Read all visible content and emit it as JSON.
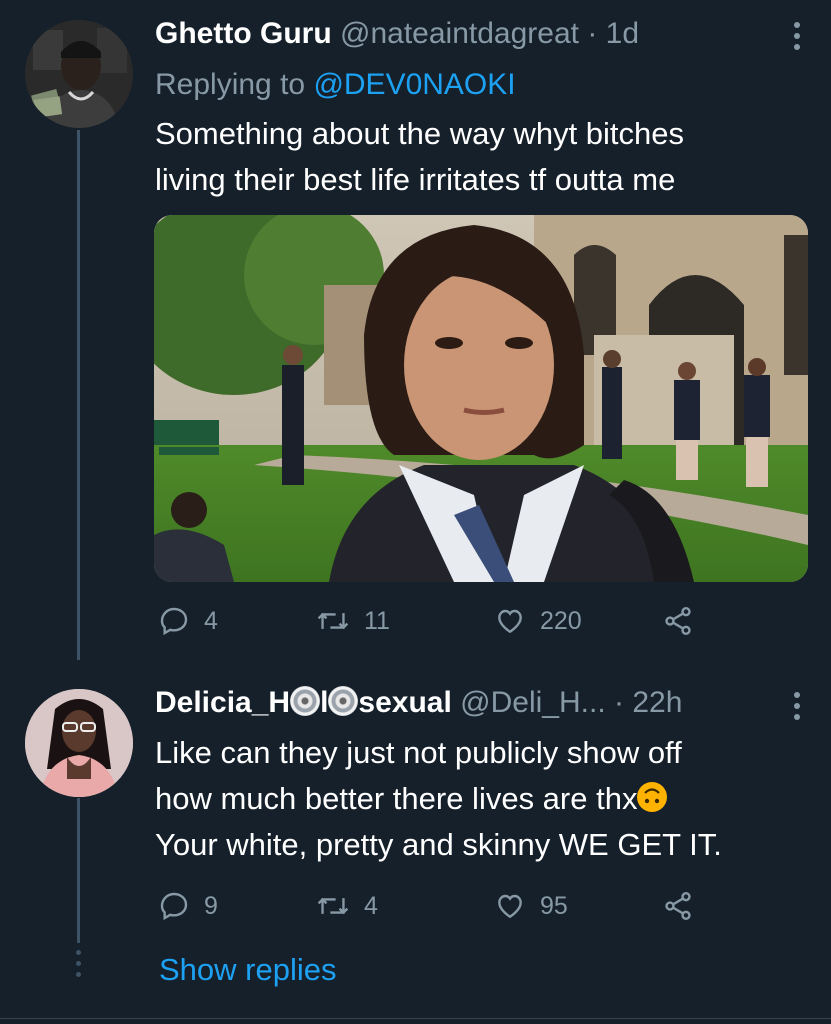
{
  "tweet1": {
    "display_name": "Ghetto Guru",
    "handle": "@nateaintdagreat",
    "time": "· 1d",
    "replying_prefix": "Replying to",
    "replying_handle": "@DEV0NAOKI",
    "text_line1": "Something about the way whyt bitches",
    "text_line2": "living their best life irritates tf outta me",
    "actions": {
      "replies": "4",
      "retweets": "11",
      "likes": "220"
    }
  },
  "tweet2": {
    "display_name_a": "Delicia_H",
    "display_name_b": "l",
    "display_name_c": "sexual",
    "handle": "@Deli_H...",
    "time": "· 22h",
    "text_line1": "Like can they just not publicly show off",
    "text_line2": "how much better there lives are thx",
    "text_line3": "Your white, pretty and skinny WE GET IT.",
    "actions": {
      "replies": "9",
      "retweets": "4",
      "likes": "95"
    }
  },
  "show_replies": "Show replies",
  "icons": {
    "more": "more-vertical-icon",
    "reply": "reply-icon",
    "retweet": "retweet-icon",
    "like": "heart-icon",
    "share": "share-icon",
    "name_emoji": "disc-icon",
    "text_emoji": "upside-down-face-icon"
  },
  "colors": {
    "background": "#15202b",
    "link": "#1da1f2",
    "muted": "#8899a6",
    "thread_line": "#3d5466"
  }
}
